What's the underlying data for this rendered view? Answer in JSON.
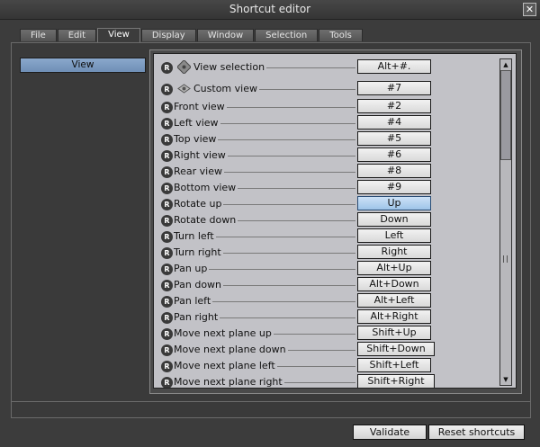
{
  "window": {
    "title": "Shortcut editor",
    "close_label": "✕"
  },
  "tabs": [
    {
      "label": "File"
    },
    {
      "label": "Edit"
    },
    {
      "label": "View",
      "active": true
    },
    {
      "label": "Display"
    },
    {
      "label": "Window"
    },
    {
      "label": "Selection"
    },
    {
      "label": "Tools"
    }
  ],
  "sidebar": {
    "selected_label": "View"
  },
  "shortcuts": [
    {
      "label": "View selection",
      "key": "Alt+#.",
      "icon": "view-selection-icon"
    },
    {
      "label": "Custom view",
      "key": "#7",
      "icon": "custom-view-icon"
    },
    {
      "label": "Front view",
      "key": "#2"
    },
    {
      "label": "Left view",
      "key": "#4"
    },
    {
      "label": "Top view",
      "key": "#5"
    },
    {
      "label": "Right view",
      "key": "#6"
    },
    {
      "label": "Rear view",
      "key": "#8"
    },
    {
      "label": "Bottom view",
      "key": "#9"
    },
    {
      "label": "Rotate up",
      "key": "Up",
      "active": true
    },
    {
      "label": "Rotate down",
      "key": "Down"
    },
    {
      "label": "Turn left",
      "key": "Left"
    },
    {
      "label": "Turn right",
      "key": "Right"
    },
    {
      "label": "Pan up",
      "key": "Alt+Up"
    },
    {
      "label": "Pan down",
      "key": "Alt+Down"
    },
    {
      "label": "Pan left",
      "key": "Alt+Left"
    },
    {
      "label": "Pan right",
      "key": "Alt+Right"
    },
    {
      "label": "Move next plane up",
      "key": "Shift+Up"
    },
    {
      "label": "Move next plane down",
      "key": "Shift+Down"
    },
    {
      "label": "Move next plane left",
      "key": "Shift+Left"
    },
    {
      "label": "Move next plane right",
      "key": "Shift+Right"
    }
  ],
  "reset_badge": "R",
  "footer": {
    "validate_label": "Validate",
    "reset_label": "Reset shortcuts"
  },
  "colors": {
    "accent": "#7fa0c8",
    "active_key": "#b5d3f0"
  }
}
